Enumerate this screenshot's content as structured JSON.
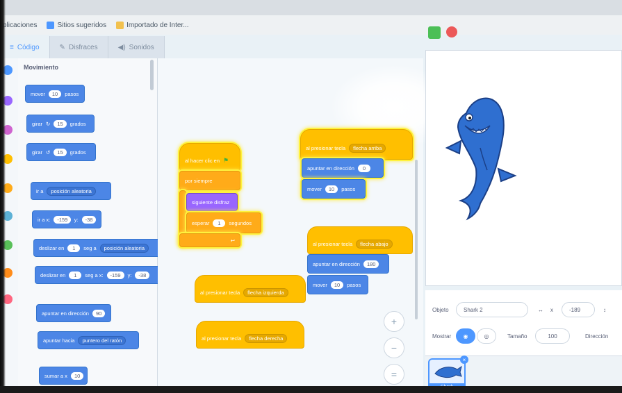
{
  "bookmarks": {
    "apps": "plicaciones",
    "suggested": "Sitios sugeridos",
    "imported": "Importado de Inter..."
  },
  "tabs": [
    {
      "label": "Código",
      "icon": "code-icon"
    },
    {
      "label": "Disfraces",
      "icon": "brush-icon"
    },
    {
      "label": "Sonidos",
      "icon": "speaker-icon"
    }
  ],
  "palette": {
    "title": "Movimiento",
    "blocks": {
      "move": {
        "text": "mover",
        "value": "10",
        "suffix": "pasos"
      },
      "turn_right": {
        "text": "girar",
        "value": "15",
        "suffix": "grados"
      },
      "turn_left": {
        "text": "girar",
        "value": "15",
        "suffix": "grados"
      },
      "goto": {
        "text": "ir a",
        "dropdown": "posición aleatoria"
      },
      "goto_xy": {
        "text": "ir a x:",
        "x": "-159",
        "ylabel": "y:",
        "y": "-38"
      },
      "glide_to": {
        "text": "deslizar en",
        "secs": "1",
        "mid": "seg a",
        "dropdown": "posición aleatoria"
      },
      "glide_xy": {
        "text": "deslizar en",
        "secs": "1",
        "mid": "seg a x:",
        "x": "-159",
        "ylabel": "y:",
        "y": "-38"
      },
      "point_dir": {
        "text": "apuntar en dirección",
        "value": "90"
      },
      "point_towards": {
        "text": "apuntar hacia",
        "dropdown": "puntero del ratón"
      },
      "change_x": {
        "text": "sumar a x",
        "value": "10"
      }
    }
  },
  "workspace": {
    "script1": {
      "hat": "al hacer clic en",
      "forever": "por siempre",
      "next_costume": "siguiente disfraz",
      "wait": "esperar",
      "wait_value": "1",
      "wait_suffix": "segundos"
    },
    "script2": {
      "hat": "al presionar tecla",
      "key": "flecha arriba",
      "point": "apuntar en dirección",
      "point_value": "0",
      "move": "mover",
      "move_value": "10",
      "move_suffix": "pasos"
    },
    "script3": {
      "hat": "al presionar tecla",
      "key": "flecha abajo",
      "point": "apuntar en dirección",
      "point_value": "180",
      "move": "mover",
      "move_value": "10",
      "move_suffix": "pasos"
    },
    "script4": {
      "hat": "al presionar tecla",
      "key": "flecha izquierda"
    },
    "script5": {
      "hat": "al presionar tecla",
      "key": "flecha derecha"
    },
    "zoom_in": "+",
    "zoom_out": "−",
    "zoom_reset": "="
  },
  "sprite_info": {
    "sprite_label": "Objeto",
    "sprite_name": "Shark 2",
    "x_label": "x",
    "x_value": "-189",
    "show_label": "Mostrar",
    "size_label": "Tamaño",
    "size_value": "100",
    "direction_label": "Dirección",
    "thumb_name": "Shark"
  },
  "colors": {
    "motion": "#4c86e6",
    "events": "#ffbf00",
    "control": "#ffab19",
    "looks": "#9966ff",
    "accent": "#4d97ff"
  }
}
